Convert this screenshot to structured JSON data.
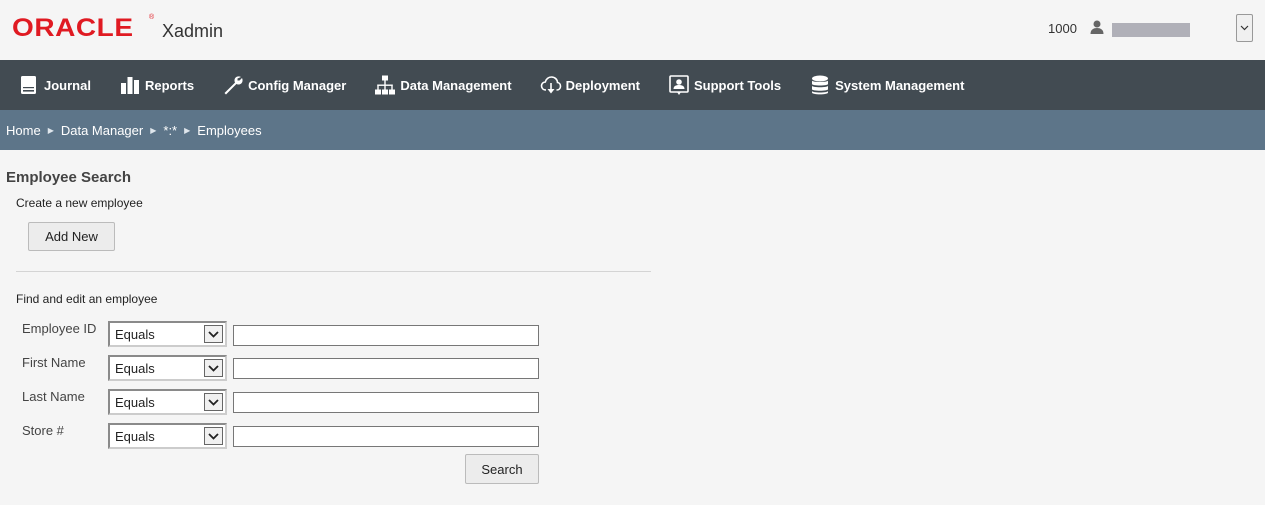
{
  "header": {
    "logo_text": "ORACLE",
    "app_name": "Xadmin",
    "user_id": "1000"
  },
  "nav": {
    "items": [
      {
        "label": "Journal",
        "icon": "journal-icon"
      },
      {
        "label": "Reports",
        "icon": "bar-chart-icon"
      },
      {
        "label": "Config Manager",
        "icon": "wrench-icon"
      },
      {
        "label": "Data Management",
        "icon": "hierarchy-icon"
      },
      {
        "label": "Deployment",
        "icon": "cloud-download-icon"
      },
      {
        "label": "Support Tools",
        "icon": "support-icon"
      },
      {
        "label": "System Management",
        "icon": "database-icon"
      }
    ]
  },
  "breadcrumb": [
    "Home",
    "Data Manager",
    "*:*",
    "Employees"
  ],
  "page": {
    "title": "Employee Search",
    "create_label": "Create a new employee",
    "add_button": "Add New",
    "find_label": "Find and edit an employee",
    "search_button": "Search",
    "fields": [
      {
        "label": "Employee ID",
        "operator": "Equals",
        "value": ""
      },
      {
        "label": "First Name",
        "operator": "Equals",
        "value": ""
      },
      {
        "label": "Last Name",
        "operator": "Equals",
        "value": ""
      },
      {
        "label": "Store #",
        "operator": "Equals",
        "value": ""
      }
    ]
  },
  "colors": {
    "brand_red": "#e01a22",
    "nav_bg": "#424b52",
    "breadcrumb_bg": "#5d7589"
  }
}
